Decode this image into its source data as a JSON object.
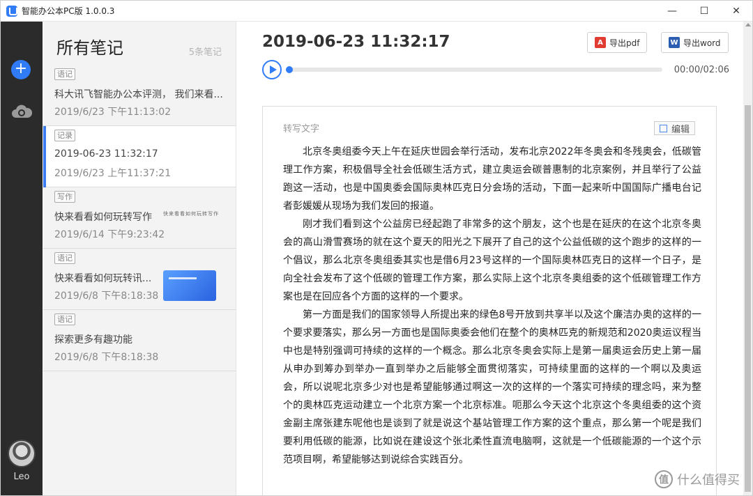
{
  "titlebar": {
    "title": "智能办公本PC版 1.0.0.3",
    "minimize": "—",
    "maximize": "☐",
    "close": "✕"
  },
  "rail": {
    "add_glyph": "+",
    "user_name": "Leo"
  },
  "list": {
    "title": "所有笔记",
    "count": "5条笔记",
    "notes": [
      {
        "tag": "语记",
        "title": "科大讯飞智能办公本评测， 我们来看...",
        "date": "2019/6/23 下午11:13:02"
      },
      {
        "tag": "记录",
        "title": "2019-06-23 11:32:17",
        "date": "2019/6/23 上午11:37:21"
      },
      {
        "tag": "写作",
        "title": "快来看看如何玩转写作",
        "date": "2019/6/14 下午9:23:42",
        "hand": "快来看看如何玩转写作"
      },
      {
        "tag": "语记",
        "title": "快来看看如何玩转讯...",
        "date": "2019/6/8 下午8:18:38"
      },
      {
        "tag": "语记",
        "title": "探索更多有趣功能",
        "date": "2019/6/8 下午8:18:38"
      }
    ]
  },
  "detail": {
    "datetime": "2019-06-23 11:32:17",
    "export_pdf": "导出pdf",
    "export_word": "导出word",
    "pdf_icon": "A",
    "word_icon": "W",
    "audio_time": "00:00/02:06",
    "audio_progress": 0.0,
    "panel_label": "转写文字",
    "edit_label": "编辑",
    "paragraphs": [
      "北京冬奥组委今天上午在延庆世园会举行活动，发布北京2022年冬奥会和冬残奥会，低碳管理工作方案，积极倡导全社会低碳生活方式，建立奥运会碳普惠制的北京案例，并且举行了公益跑这一活动，也是中国奥委会国际奥林匹克日分会场的活动，下面一起来听中国国际广播电台记者彭媛媛从现场为我们发回的报道。",
      "刚才我们看到这个公益房已经起跑了非常多的这个朋友，这个也是在延庆的在这个北京冬奥会的高山滑雪赛场的就在这个夏天的阳光之下展开了自己的这个公益低碳的这个跑步的这样的一个倡议，那么北京冬奥组委其实也是借6月23号这样的一个国际奥林匹克日的这样一个日子，是向全社会发布了这个低碳的管理工作方案，那么实际上这个北京冬奥组委的这个低碳管理工作方案也是在回应各个方面的这样的一个要求。",
      "第一方面是我们的国家领导人所提出来的绿色8号开放到共享半以及这个廉洁办奥的这样的一个要求要落实，那么另一方面也是国际奥委会他们在整个的奥林匹克的新规范和2020奥运议程当中也是特别强调可持续的这样的一个概念。那么北京冬奥会实际上是第一届奥运会历史上第一届从申办到筹办到举办一直到举办之后能够全面贯彻落实，可持续里面的这样的一个啊以及奥运会，所以说呢北京多少对也是希望能够通过啊这一次的这样的一个落实可持续的理念吗，来为整个的奥林匹克运动建立一个北京方案一个北京标准。呃那么今天这个北京这个冬奥组委的这个资金副主席张建东呢他也是谈到了就是说这个基站管理工作方案的这个重点，那么第一个呢是我们要利用低碳的能源，比如说在建设这个张北柔性直流电脑啊，这就是一个低碳能源的一个这个示范项目啊，希望能够达到说综合实践百分。"
    ]
  },
  "watermark": {
    "logo": "值",
    "text": "什么值得买"
  }
}
